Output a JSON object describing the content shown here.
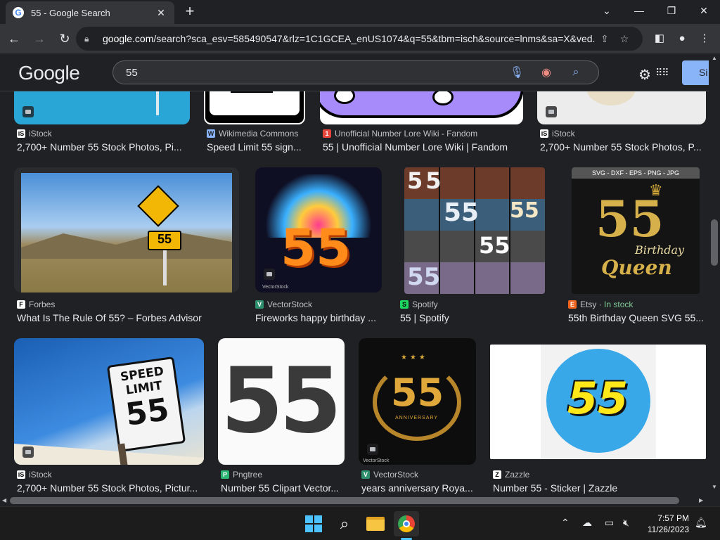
{
  "browser": {
    "tab_title": "55 - Google Search",
    "tab_favicon": "G",
    "url_host": "google.com",
    "url_rest": "/search?sca_esv=585490547&rlz=1C1GCEA_enUS1074&q=55&tbm=isch&source=lnms&sa=X&ved..."
  },
  "google": {
    "logo": "Google",
    "query": "55",
    "signin_label": "Si"
  },
  "row0": [
    {
      "source": "iStock",
      "caption": "2,700+ Number 55 Stock Photos, Pi..."
    },
    {
      "source": "Wikimedia Commons",
      "caption": "Speed Limit 55 sign..."
    },
    {
      "source": "Unofficial Number Lore Wiki - Fandom",
      "caption": "55 | Unofficial Number Lore Wiki | Fandom"
    },
    {
      "source": "iStock",
      "caption": "2,700+ Number 55 Stock Photos, P..."
    }
  ],
  "row1": [
    {
      "source": "Forbes",
      "caption": "What Is The Rule Of 55? – Forbes Advisor",
      "sign_text": "55"
    },
    {
      "source": "VectorStock",
      "caption": "Fireworks happy birthday ...",
      "big": "55",
      "watermark": "VectorStock"
    },
    {
      "source": "Spotify",
      "caption": "55 | Spotify",
      "big": "55"
    },
    {
      "source": "Etsy",
      "source_extra": "In stock",
      "caption": "55th Birthday Queen SVG 55...",
      "banner": "SVG - DXF - EPS - PNG - JPG",
      "big": "55",
      "script1": "Birthday",
      "script2": "Queen"
    }
  ],
  "row2": [
    {
      "source": "iStock",
      "caption": "2,700+ Number 55 Stock Photos, Pictur...",
      "sign_line1": "SPEED",
      "sign_line2": "LIMIT",
      "sign_num": "55"
    },
    {
      "source": "Pngtree",
      "caption": "Number 55 Clipart Vector...",
      "big": "55"
    },
    {
      "source": "VectorStock",
      "caption": "years anniversary Roya...",
      "big": "55",
      "sub": "ANNIVERSARY",
      "watermark": "VectorStock"
    },
    {
      "source": "Zazzle",
      "caption": "Number 55 - Sticker | Zazzle",
      "big": "55"
    }
  ],
  "taskbar": {
    "time": "7:57 PM",
    "date": "11/26/2023"
  }
}
